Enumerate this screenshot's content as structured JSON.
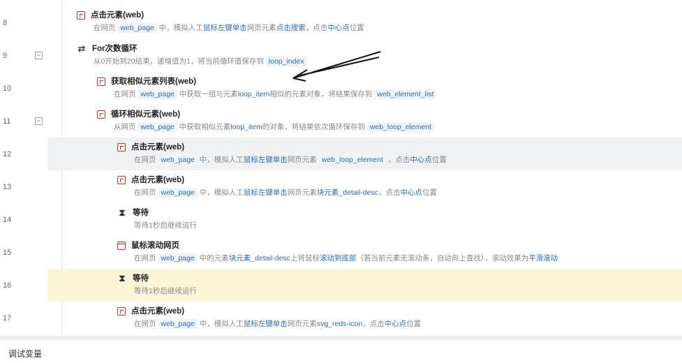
{
  "rows": [
    {
      "line": "8",
      "title": "点击元素(web)",
      "desc": [
        "在网页 ",
        "web_page",
        " 中，模拟人工",
        "鼠标左键单击",
        "网页元素",
        "点击搜索",
        "，点击",
        "中心点",
        "位置"
      ]
    },
    {
      "line": "9",
      "title": "For次数循环",
      "desc": [
        "从0开始到20结束，递增值为1，将当前循环值保存到 ",
        "loop_index"
      ]
    },
    {
      "line": "10",
      "title": "获取相似元素列表(web)",
      "desc": [
        "在网页 ",
        "web_page",
        " 中获取一组与元素",
        "loop_item",
        "相似的元素对象，将结果保存到 ",
        "web_element_list"
      ]
    },
    {
      "line": "11",
      "title": "循环相似元素(web)",
      "desc": [
        "从网页 ",
        "web_page",
        " 中获取相似元素",
        "loop_item",
        "的对象，将结果依次循环保存到 ",
        "web_loop_element"
      ]
    },
    {
      "line": "12",
      "title": "点击元素(web)",
      "desc": [
        "在网页 ",
        "web_page",
        " 中，模拟人工",
        "鼠标左键单击",
        "网页元素 ",
        "web_loop_element",
        " ，点击",
        "中心点",
        "位置"
      ]
    },
    {
      "line": "13",
      "title": "点击元素(web)",
      "desc": [
        "在网页 ",
        "web_page",
        " 中，模拟人工",
        "鼠标左键单击",
        "网页元素",
        "块元素_detail-desc",
        "，点击",
        "中心点",
        "位置"
      ]
    },
    {
      "line": "14",
      "title": "等待",
      "desc": [
        "等待1秒后继续运行"
      ]
    },
    {
      "line": "15",
      "title": "鼠标滚动网页",
      "desc": [
        "在网页 ",
        "web_page",
        " 中的元素",
        "块元素_detail-desc",
        "上将鼠标",
        "滚动到底部",
        "（若当前元素无滚动条，自动向上查找），滚动效果为",
        "平滑滚动"
      ]
    },
    {
      "line": "16",
      "title": "等待",
      "desc": [
        "等待1秒后继续运行"
      ]
    },
    {
      "line": "17",
      "title": "点击元素(web)",
      "desc": [
        "在网页 ",
        "web_page",
        " 中，模拟人工",
        "鼠标左键单击",
        "网页元素",
        "svg_reds-icon",
        "，点击",
        "中心点",
        "位置"
      ]
    }
  ],
  "collapse_symbol": "−",
  "debug_panel": {
    "label": "调试变量"
  },
  "icons": {
    "click": "click-element-icon",
    "loop": "loop-icon",
    "wait": "hourglass-icon",
    "scroll": "scroll-page-icon"
  }
}
